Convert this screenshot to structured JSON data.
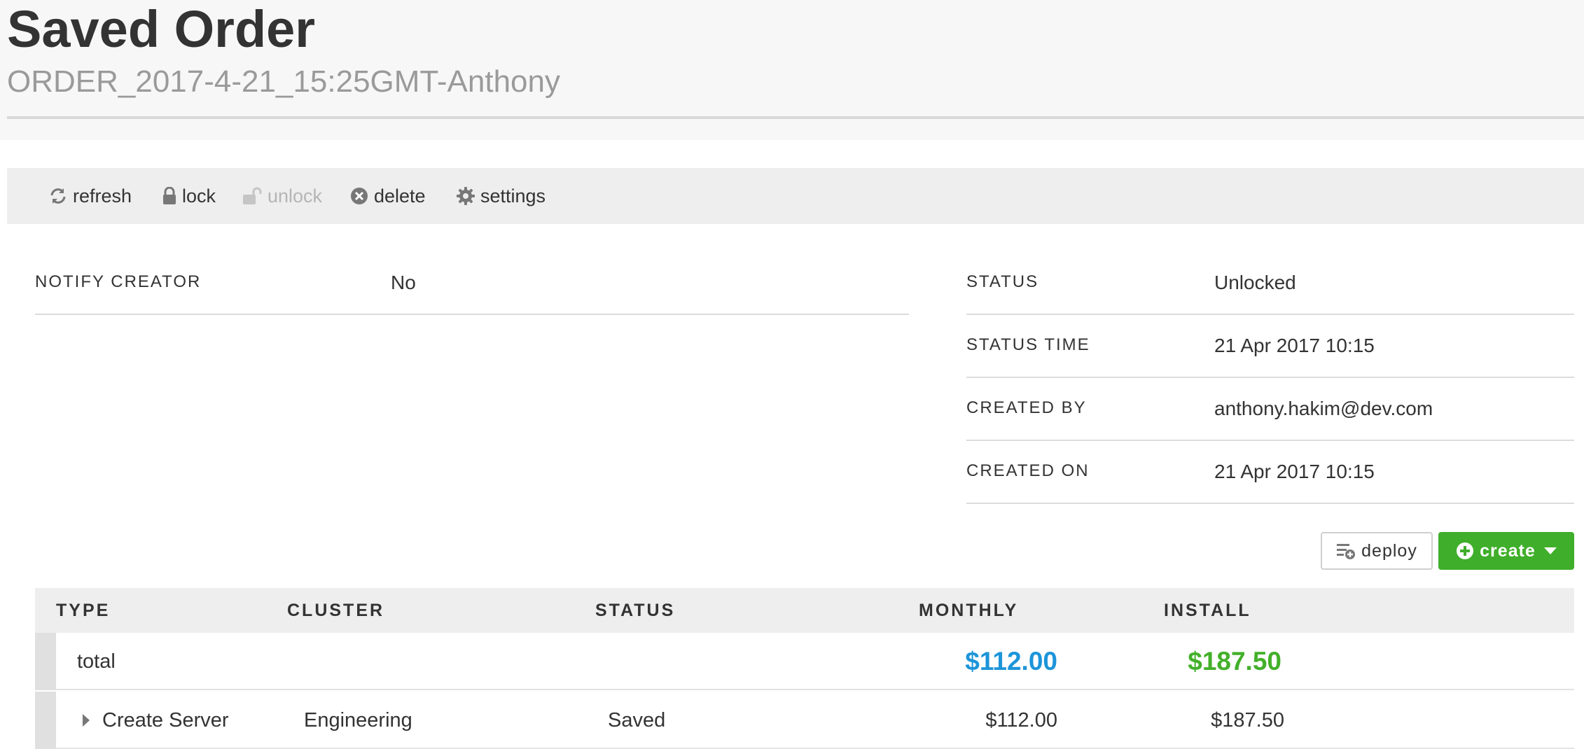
{
  "header": {
    "title": "Saved Order",
    "subtitle": "ORDER_2017-4-21_15:25GMT-Anthony"
  },
  "toolbar": {
    "refresh": "refresh",
    "lock": "lock",
    "unlock": "unlock",
    "delete": "delete",
    "settings": "settings"
  },
  "details_left": [
    {
      "label": "NOTIFY CREATOR",
      "value": "No"
    }
  ],
  "details_right": [
    {
      "label": "STATUS",
      "value": "Unlocked"
    },
    {
      "label": "STATUS TIME",
      "value": "21 Apr 2017 10:15"
    },
    {
      "label": "CREATED BY",
      "value": "anthony.hakim@dev.com"
    },
    {
      "label": "CREATED ON",
      "value": "21 Apr 2017 10:15"
    }
  ],
  "actions": {
    "deploy": "deploy",
    "create": "create"
  },
  "table": {
    "columns": [
      "TYPE",
      "CLUSTER",
      "STATUS",
      "MONTHLY",
      "INSTALL"
    ],
    "total": {
      "label": "total",
      "monthly": "$112.00",
      "install": "$187.50"
    },
    "rows": [
      {
        "type": "Create Server",
        "cluster": "Engineering",
        "status": "Saved",
        "monthly": "$112.00",
        "install": "$187.50"
      }
    ]
  },
  "colors": {
    "accent_green": "#3fae2a",
    "monthly_blue": "#1d95d9",
    "install_green": "#43b02a"
  }
}
